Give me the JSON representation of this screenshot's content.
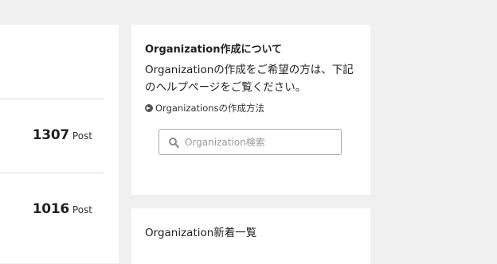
{
  "stats": [
    {
      "count": "1307",
      "unit": "Post"
    },
    {
      "count": "1016",
      "unit": "Post"
    }
  ],
  "about_card": {
    "title": "Organization作成について",
    "description_line1": "Organizationの作成をご希望の方は、下記",
    "description_line2": "のヘルプページをご覧ください。",
    "help_link_label": "Organizationsの作成方法",
    "help_link_icon": "circle-arrow-right-icon"
  },
  "search": {
    "placeholder": "Organization検索",
    "value": "",
    "icon": "search-icon"
  },
  "latest_card": {
    "title": "Organization新着一覧"
  }
}
